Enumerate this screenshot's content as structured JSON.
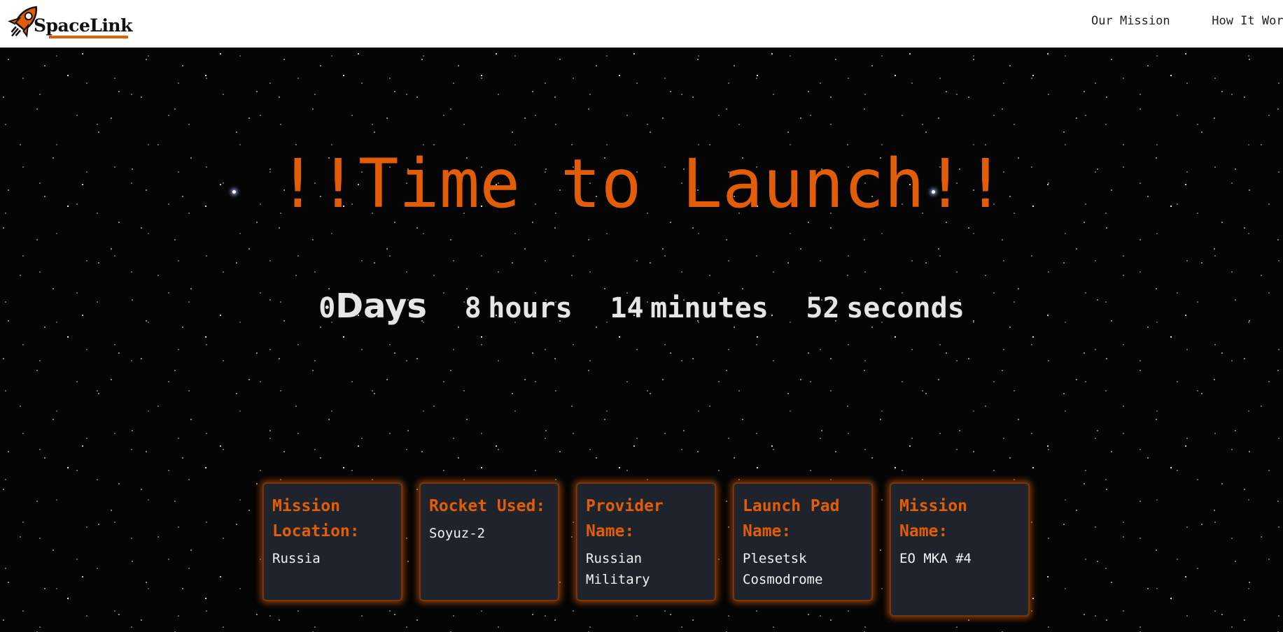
{
  "brand": {
    "name": "SpaceLink"
  },
  "nav": {
    "links": [
      "Our Mission",
      "How It Works"
    ]
  },
  "hero": {
    "title": "!!Time to Launch!!"
  },
  "countdown": {
    "days": "0",
    "days_label": "Days",
    "hours": "8",
    "hours_label": "hours",
    "minutes": "14",
    "minutes_label": "minutes",
    "seconds": "52",
    "seconds_label": "seconds"
  },
  "cards": [
    {
      "title": "Mission Location:",
      "value": "Russia"
    },
    {
      "title": "Rocket Used:",
      "value": "Soyuz-2"
    },
    {
      "title": "Provider Name:",
      "value": "Russian Military"
    },
    {
      "title": "Launch Pad Name:",
      "value": "Plesetsk Cosmodrome"
    },
    {
      "title": "Mission Name:",
      "value": "EO MKA #4"
    }
  ],
  "colors": {
    "accent": "#e35d06",
    "card_bg": "#1f242c",
    "text_light": "#e6e6e6"
  },
  "icons": {
    "logo": "rocket-icon"
  }
}
